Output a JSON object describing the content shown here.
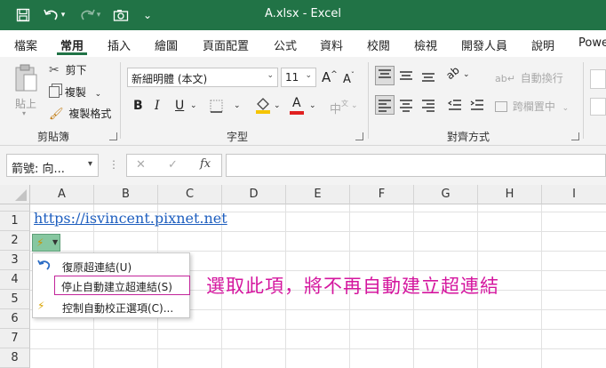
{
  "titlebar": {
    "title": "A.xlsx  -  Excel",
    "qa_more": "⌄"
  },
  "menu": {
    "tabs": [
      "檔案",
      "常用",
      "插入",
      "繪圖",
      "頁面配置",
      "公式",
      "資料",
      "校閱",
      "檢視",
      "開發人員",
      "說明",
      "Powe"
    ]
  },
  "ribbon": {
    "clipboard": {
      "paste_label": "貼上",
      "cut": "剪下",
      "copy": "複製",
      "format_painter": "複製格式",
      "group_label": "剪貼簿"
    },
    "font": {
      "font_name": "新細明體 (本文)",
      "font_size": "11",
      "grow": "A",
      "shrink": "A",
      "bold": "B",
      "italic": "I",
      "underline": "U",
      "font_color_glyph": "A",
      "phonetic": "中",
      "group_label": "字型"
    },
    "alignment": {
      "wrap_text": "自動換行",
      "merge_center": "跨欄置中",
      "group_label": "對齊方式"
    }
  },
  "formula_bar": {
    "name_box": "箭號: 向...",
    "cancel": "✕",
    "enter": "✓",
    "fx": "fx"
  },
  "grid": {
    "columns": [
      "A",
      "B",
      "C",
      "D",
      "E",
      "F",
      "G",
      "H",
      "I"
    ],
    "rows": [
      "1",
      "2",
      "3",
      "4",
      "5",
      "6",
      "7",
      "8"
    ],
    "a1_link": "https://isvincent.pixnet.net"
  },
  "context_menu": {
    "items": [
      {
        "label": "復原超連結(U)"
      },
      {
        "label": "停止自動建立超連結(S)"
      },
      {
        "label": "控制自動校正選項(C)..."
      }
    ]
  },
  "annotation": "選取此項，將不再自動建立超連結",
  "colors": {
    "brand": "#217346",
    "highlight_border": "#c2249a",
    "annotation": "#d4159e",
    "hyperlink": "#1f5fbf",
    "font_color_bar": "#e02020",
    "fill_color_bar": "#f5c400"
  }
}
